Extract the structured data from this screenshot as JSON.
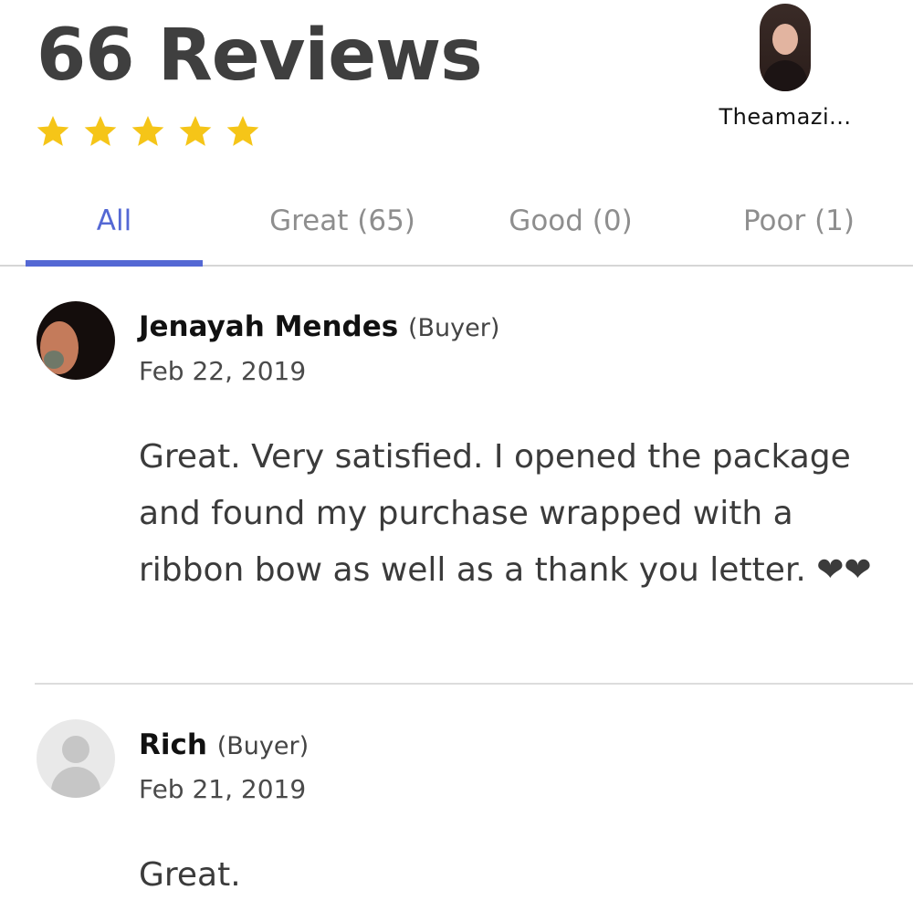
{
  "header": {
    "title": "66 Reviews",
    "rating_stars": 5,
    "star_color": "#f5c518"
  },
  "seller": {
    "name": "Theamazi..."
  },
  "tabs": [
    {
      "label": "All",
      "active": true
    },
    {
      "label": "Great (65)",
      "active": false
    },
    {
      "label": "Good (0)",
      "active": false
    },
    {
      "label": "Poor (1)",
      "active": false
    }
  ],
  "accent_color": "#5468d4",
  "reviews": [
    {
      "name": "Jenayah Mendes",
      "role": "(Buyer)",
      "date": "Feb 22, 2019",
      "text": "Great. Very satisfied. I opened the package and found my purchase wrapped with a ribbon bow as well as a thank you letter. ❤❤"
    },
    {
      "name": "Rich",
      "role": "(Buyer)",
      "date": "Feb 21, 2019",
      "text": "Great."
    }
  ]
}
